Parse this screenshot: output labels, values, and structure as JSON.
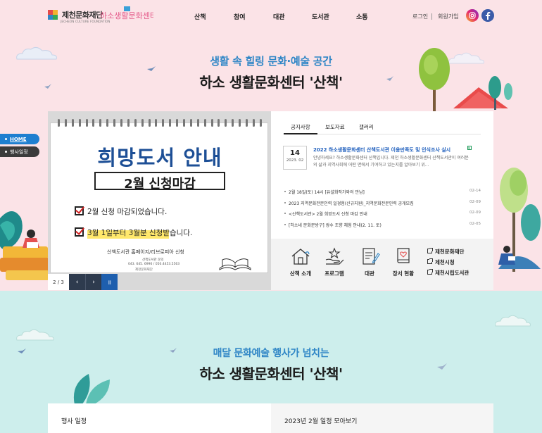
{
  "header": {
    "org_name": "제천문화재단",
    "org_sub": "JECHEON CULTURE FOUNDATION",
    "logo_text": "하소생활문화센터 산책",
    "nav": [
      "산책",
      "참여",
      "대관",
      "도서관",
      "소통"
    ],
    "login": "로그인",
    "signup": "회원가입",
    "sns": [
      "instagram-icon",
      "facebook-icon"
    ]
  },
  "hero": {
    "subtitle": "생활 속 힐링 문화·예술 공간",
    "title": "하소 생활문화센터 '산책'"
  },
  "quick_menu": [
    {
      "label": "HOME"
    },
    {
      "label": "행사일정"
    }
  ],
  "slider": {
    "poster_title": "희망도서 안내",
    "poster_deadline": "2월 신청마감",
    "line1": "2월 신청 마감되었습니다.",
    "line2": "3월 1일부터 3월분 신청받습니다.",
    "line3": "산책도서관 홈페이지/리브로피아 신청",
    "contact_label": "산책도서관 문의",
    "contact_phone": "043. 645. 6990 / 050.4453.5563",
    "footer_logo": "제천문화재단",
    "counter": "2 / 3",
    "prev_label": "‹",
    "next_label": "›",
    "pause_label": "॥"
  },
  "news": {
    "tabs": [
      "공지사항",
      "보도자료",
      "갤러리"
    ],
    "featured": {
      "day": "14",
      "ym": "2023. 02",
      "title": "2022 하소생활문화센터 산책도서관 이용만족도 및 인식조사 실시",
      "badge": "N",
      "body": "안녕하세요? 하소생활문화센터 산책입니다. 제천 하소생활문화센터 산책도서관이 여러분의 삶과 지역사회에 어떤 면에서 기여하고 있는지를 알아보기 위..."
    },
    "items": [
      {
        "text": "2월 18일(토) 14시 [유설화작가와의 만남]",
        "date": "02-14"
      },
      {
        "text": "2023 지역문화전문인력 일경험(신규지원)_지역문화전문인력 공개모집",
        "date": "02-09"
      },
      {
        "text": "<산책도서관> 2월 희망도서 신청 마감 안내",
        "date": "02-09"
      },
      {
        "text": "[하소네 문화문방구] 쌍수 조향 체험 안내(2. 11. 토)",
        "date": "02-05"
      }
    ]
  },
  "shortcuts": {
    "items": [
      {
        "label": "산책 소개",
        "icon": "house-icon"
      },
      {
        "label": "프로그램",
        "icon": "hand-star-icon"
      },
      {
        "label": "대관",
        "icon": "document-pen-icon"
      },
      {
        "label": "장서 현황",
        "icon": "book-heart-icon"
      }
    ],
    "links": [
      "제천문화재단",
      "제천시청",
      "제천시립도서관"
    ]
  },
  "events": {
    "subtitle": "매달 문화예술 행사가 넘치는",
    "title": "하소 생활문화센터 '산책'",
    "left_head": "행사 일정",
    "right_head": "2023년 2월 일정 모아보기"
  },
  "colors": {
    "hero_bg": "#fbe3e7",
    "lower_bg": "#cdeeec",
    "accent_blue": "#2f86c6",
    "link_blue": "#1f5fbd",
    "poster_blue": "#1d4f96",
    "dark_btn": "#2e3b4e",
    "pause_btn": "#1e5fae"
  }
}
